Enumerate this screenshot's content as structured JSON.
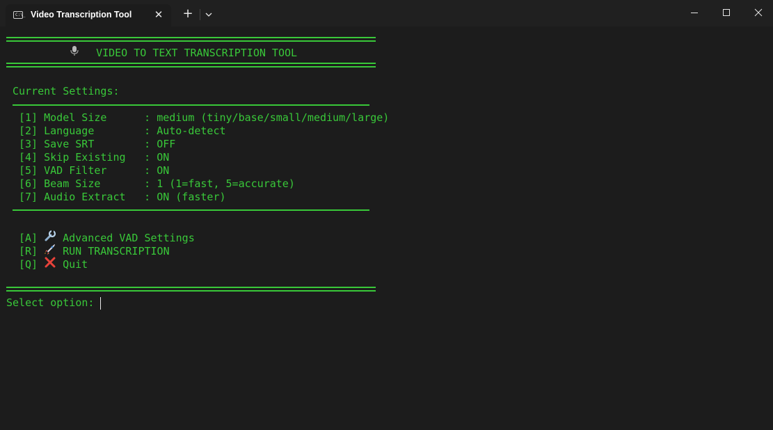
{
  "window": {
    "tab_title": "Video Transcription Tool",
    "tab_icon_text": "C:\\_",
    "new_tab_symbol": "+",
    "close_tab_symbol": "✕"
  },
  "terminal": {
    "header_title": "VIDEO TO TEXT TRANSCRIPTION TOOL",
    "section_title": "Current Settings:",
    "settings": [
      {
        "key": "[1]",
        "label": "Model Size",
        "value": "medium (tiny/base/small/medium/large)"
      },
      {
        "key": "[2]",
        "label": "Language",
        "value": "Auto-detect"
      },
      {
        "key": "[3]",
        "label": "Save SRT",
        "value": "OFF"
      },
      {
        "key": "[4]",
        "label": "Skip Existing",
        "value": "ON"
      },
      {
        "key": "[5]",
        "label": "VAD Filter",
        "value": "ON"
      },
      {
        "key": "[6]",
        "label": "Beam Size",
        "value": "1 (1=fast, 5=accurate)"
      },
      {
        "key": "[7]",
        "label": "Audio Extract",
        "value": "ON (faster)"
      }
    ],
    "actions": [
      {
        "key": "[A]",
        "icon": "wrench-icon",
        "label": "Advanced VAD Settings"
      },
      {
        "key": "[R]",
        "icon": "rocket-icon",
        "label": "RUN TRANSCRIPTION"
      },
      {
        "key": "[Q]",
        "icon": "cross-mark-icon",
        "label": "Quit"
      }
    ],
    "prompt": "Select option: "
  },
  "colors": {
    "terminal_text": "#39c839",
    "terminal_bg": "#1c1c1c",
    "titlebar_bg": "#202020"
  }
}
